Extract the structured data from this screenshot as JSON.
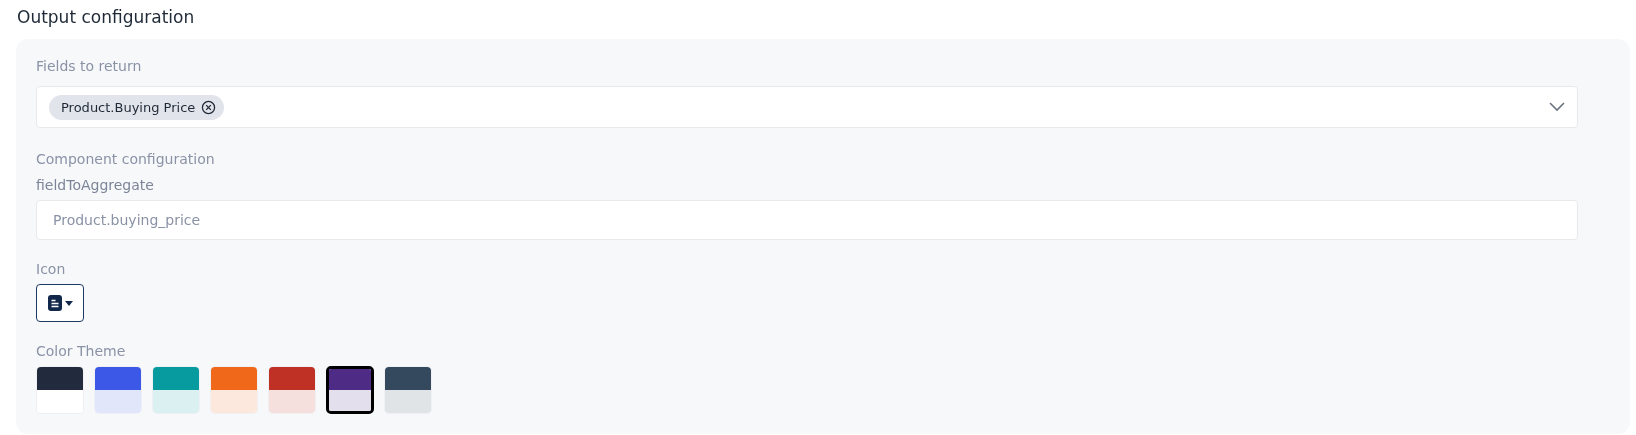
{
  "section_title": "Output configuration",
  "fields_to_return": {
    "label": "Fields to return",
    "chips": [
      {
        "label": "Product.Buying Price"
      }
    ]
  },
  "component_configuration": {
    "label": "Component configuration"
  },
  "field_to_aggregate": {
    "label": "fieldToAggregate",
    "placeholder": "Product.buying_price"
  },
  "icon": {
    "label": "Icon"
  },
  "color_theme": {
    "label": "Color Theme",
    "swatches": [
      {
        "color": "#222b3d",
        "selected": false
      },
      {
        "color": "#3b58e6",
        "selected": false
      },
      {
        "color": "#079a9f",
        "selected": false
      },
      {
        "color": "#f0681a",
        "selected": false
      },
      {
        "color": "#be3124",
        "selected": false
      },
      {
        "color": "#4e2b85",
        "selected": true
      },
      {
        "color": "#34495e",
        "selected": false
      }
    ]
  }
}
